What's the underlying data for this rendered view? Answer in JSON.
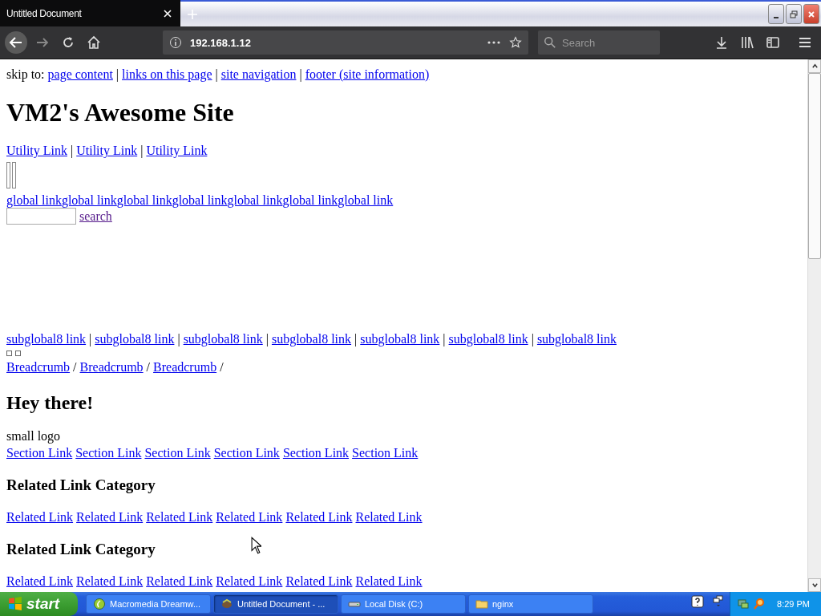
{
  "browser": {
    "tab_title": "Untitled Document",
    "url": "192.168.1.12",
    "search_placeholder": "Search"
  },
  "page": {
    "skip_label": "skip to:",
    "link_separator": "|",
    "breadcrumb_separator": "/",
    "skip_links": [
      "page content",
      "links on this page",
      "site navigation",
      "footer (site information)"
    ],
    "site_title": "VM2's Awesome Site",
    "utility_links": [
      "Utility Link",
      "Utility Link",
      "Utility Link"
    ],
    "global_links": [
      "global link",
      "global link",
      "global link",
      "global link",
      "global link",
      "global link",
      "global link"
    ],
    "search_link": "search",
    "subglobal_links": [
      "subglobal8 link",
      "subglobal8 link",
      "subglobal8 link",
      "subglobal8 link",
      "subglobal8 link",
      "subglobal8 link",
      "subglobal8 link"
    ],
    "breadcrumbs": [
      "Breadcrumb",
      "Breadcrumb",
      "Breadcrumb"
    ],
    "heading": "Hey there!",
    "small_logo": "small logo",
    "section_links": [
      "Section Link",
      "Section Link",
      "Section Link",
      "Section Link",
      "Section Link",
      "Section Link"
    ],
    "related_categories": [
      {
        "title": "Related Link Category",
        "links": [
          "Related Link",
          "Related Link",
          "Related Link",
          "Related Link",
          "Related Link",
          "Related Link"
        ]
      },
      {
        "title": "Related Link Category",
        "links": [
          "Related Link",
          "Related Link",
          "Related Link",
          "Related Link",
          "Related Link",
          "Related Link"
        ]
      }
    ]
  },
  "taskbar": {
    "start": "start",
    "items": [
      {
        "label": "Macromedia Dreamw...",
        "kind": "app",
        "selected": false
      },
      {
        "label": "Untitled Document - ...",
        "kind": "browser",
        "selected": true
      },
      {
        "label": "Local Disk (C:)",
        "kind": "disk",
        "selected": false
      },
      {
        "label": "nginx",
        "kind": "folder",
        "selected": false
      }
    ],
    "clock": "8:29 PM"
  }
}
